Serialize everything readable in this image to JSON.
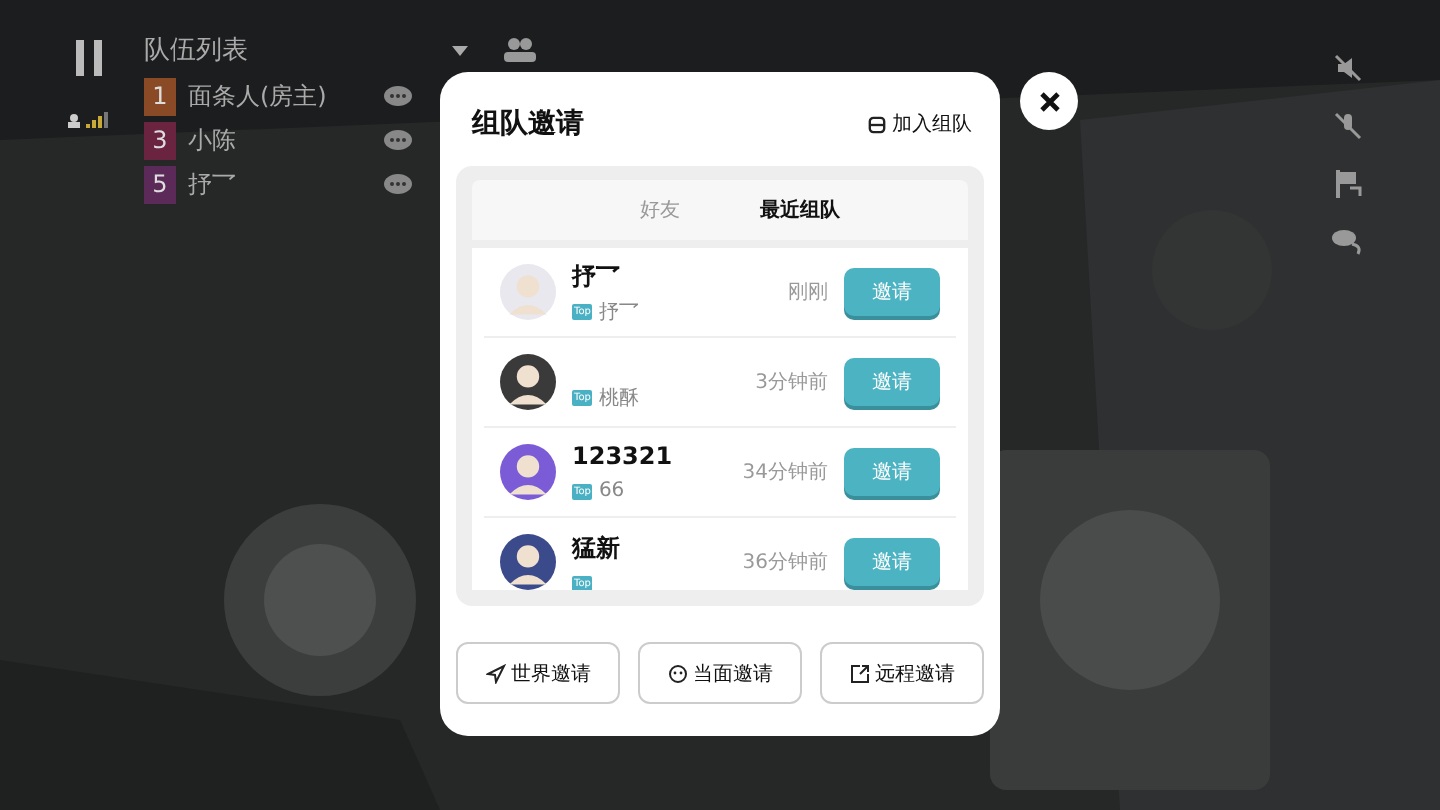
{
  "team_panel": {
    "title": "队伍列表",
    "members": [
      {
        "number": "1",
        "name": "面条人(房主)",
        "color": "#8b4a26"
      },
      {
        "number": "3",
        "name": "小陈",
        "color": "#6a2440"
      },
      {
        "number": "5",
        "name": "抒乛",
        "color": "#5c2a58"
      }
    ]
  },
  "dialog": {
    "title": "组队邀请",
    "join_label": "加入组队",
    "tabs": [
      {
        "label": "好友",
        "selected": false
      },
      {
        "label": "最近组队",
        "selected": true
      }
    ],
    "players": [
      {
        "name": "抒乛",
        "tag": "Top",
        "subtitle": "抒乛",
        "time": "刚刚",
        "button": "邀请"
      },
      {
        "tag": "Top",
        "subtitle": "桃酥",
        "time": "3分钟前",
        "button": "邀请"
      },
      {
        "name": "123321",
        "tag": "Top",
        "subtitle": "66",
        "time": "34分钟前",
        "button": "邀请"
      },
      {
        "name": "猛新",
        "tag": "Top",
        "time": "36分钟前",
        "button": "邀请"
      }
    ],
    "actions": [
      {
        "kind": "send",
        "label": "世界邀请"
      },
      {
        "kind": "face",
        "label": "当面邀请"
      },
      {
        "kind": "external",
        "label": "远程邀请"
      }
    ]
  }
}
